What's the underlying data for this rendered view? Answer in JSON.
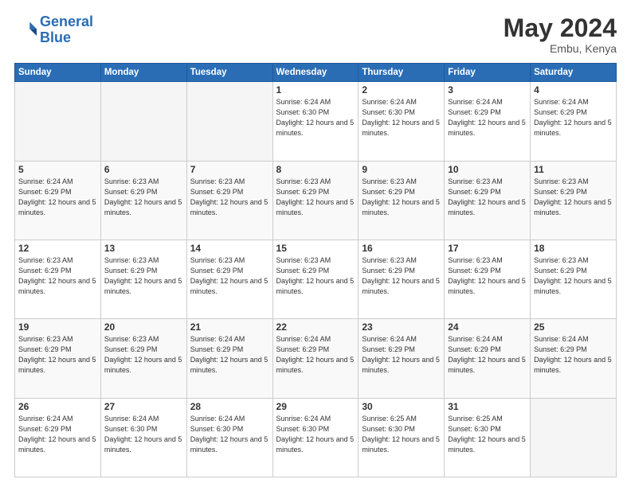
{
  "logo": {
    "line1": "General",
    "line2": "Blue"
  },
  "header": {
    "month_year": "May 2024",
    "location": "Embu, Kenya"
  },
  "weekdays": [
    "Sunday",
    "Monday",
    "Tuesday",
    "Wednesday",
    "Thursday",
    "Friday",
    "Saturday"
  ],
  "weeks": [
    [
      {
        "day": "",
        "empty": true
      },
      {
        "day": "",
        "empty": true
      },
      {
        "day": "",
        "empty": true
      },
      {
        "day": "1",
        "sunrise": "6:24 AM",
        "sunset": "6:30 PM",
        "daylight": "12 hours and 5 minutes."
      },
      {
        "day": "2",
        "sunrise": "6:24 AM",
        "sunset": "6:30 PM",
        "daylight": "12 hours and 5 minutes."
      },
      {
        "day": "3",
        "sunrise": "6:24 AM",
        "sunset": "6:29 PM",
        "daylight": "12 hours and 5 minutes."
      },
      {
        "day": "4",
        "sunrise": "6:24 AM",
        "sunset": "6:29 PM",
        "daylight": "12 hours and 5 minutes."
      }
    ],
    [
      {
        "day": "5",
        "sunrise": "6:24 AM",
        "sunset": "6:29 PM",
        "daylight": "12 hours and 5 minutes."
      },
      {
        "day": "6",
        "sunrise": "6:23 AM",
        "sunset": "6:29 PM",
        "daylight": "12 hours and 5 minutes."
      },
      {
        "day": "7",
        "sunrise": "6:23 AM",
        "sunset": "6:29 PM",
        "daylight": "12 hours and 5 minutes."
      },
      {
        "day": "8",
        "sunrise": "6:23 AM",
        "sunset": "6:29 PM",
        "daylight": "12 hours and 5 minutes."
      },
      {
        "day": "9",
        "sunrise": "6:23 AM",
        "sunset": "6:29 PM",
        "daylight": "12 hours and 5 minutes."
      },
      {
        "day": "10",
        "sunrise": "6:23 AM",
        "sunset": "6:29 PM",
        "daylight": "12 hours and 5 minutes."
      },
      {
        "day": "11",
        "sunrise": "6:23 AM",
        "sunset": "6:29 PM",
        "daylight": "12 hours and 5 minutes."
      }
    ],
    [
      {
        "day": "12",
        "sunrise": "6:23 AM",
        "sunset": "6:29 PM",
        "daylight": "12 hours and 5 minutes."
      },
      {
        "day": "13",
        "sunrise": "6:23 AM",
        "sunset": "6:29 PM",
        "daylight": "12 hours and 5 minutes."
      },
      {
        "day": "14",
        "sunrise": "6:23 AM",
        "sunset": "6:29 PM",
        "daylight": "12 hours and 5 minutes."
      },
      {
        "day": "15",
        "sunrise": "6:23 AM",
        "sunset": "6:29 PM",
        "daylight": "12 hours and 5 minutes."
      },
      {
        "day": "16",
        "sunrise": "6:23 AM",
        "sunset": "6:29 PM",
        "daylight": "12 hours and 5 minutes."
      },
      {
        "day": "17",
        "sunrise": "6:23 AM",
        "sunset": "6:29 PM",
        "daylight": "12 hours and 5 minutes."
      },
      {
        "day": "18",
        "sunrise": "6:23 AM",
        "sunset": "6:29 PM",
        "daylight": "12 hours and 5 minutes."
      }
    ],
    [
      {
        "day": "19",
        "sunrise": "6:23 AM",
        "sunset": "6:29 PM",
        "daylight": "12 hours and 5 minutes."
      },
      {
        "day": "20",
        "sunrise": "6:23 AM",
        "sunset": "6:29 PM",
        "daylight": "12 hours and 5 minutes."
      },
      {
        "day": "21",
        "sunrise": "6:24 AM",
        "sunset": "6:29 PM",
        "daylight": "12 hours and 5 minutes."
      },
      {
        "day": "22",
        "sunrise": "6:24 AM",
        "sunset": "6:29 PM",
        "daylight": "12 hours and 5 minutes."
      },
      {
        "day": "23",
        "sunrise": "6:24 AM",
        "sunset": "6:29 PM",
        "daylight": "12 hours and 5 minutes."
      },
      {
        "day": "24",
        "sunrise": "6:24 AM",
        "sunset": "6:29 PM",
        "daylight": "12 hours and 5 minutes."
      },
      {
        "day": "25",
        "sunrise": "6:24 AM",
        "sunset": "6:29 PM",
        "daylight": "12 hours and 5 minutes."
      }
    ],
    [
      {
        "day": "26",
        "sunrise": "6:24 AM",
        "sunset": "6:29 PM",
        "daylight": "12 hours and 5 minutes."
      },
      {
        "day": "27",
        "sunrise": "6:24 AM",
        "sunset": "6:30 PM",
        "daylight": "12 hours and 5 minutes."
      },
      {
        "day": "28",
        "sunrise": "6:24 AM",
        "sunset": "6:30 PM",
        "daylight": "12 hours and 5 minutes."
      },
      {
        "day": "29",
        "sunrise": "6:24 AM",
        "sunset": "6:30 PM",
        "daylight": "12 hours and 5 minutes."
      },
      {
        "day": "30",
        "sunrise": "6:25 AM",
        "sunset": "6:30 PM",
        "daylight": "12 hours and 5 minutes."
      },
      {
        "day": "31",
        "sunrise": "6:25 AM",
        "sunset": "6:30 PM",
        "daylight": "12 hours and 5 minutes."
      },
      {
        "day": "",
        "empty": true
      }
    ]
  ],
  "labels": {
    "sunrise_prefix": "Sunrise: ",
    "sunset_prefix": "Sunset: ",
    "daylight_prefix": "Daylight: "
  }
}
